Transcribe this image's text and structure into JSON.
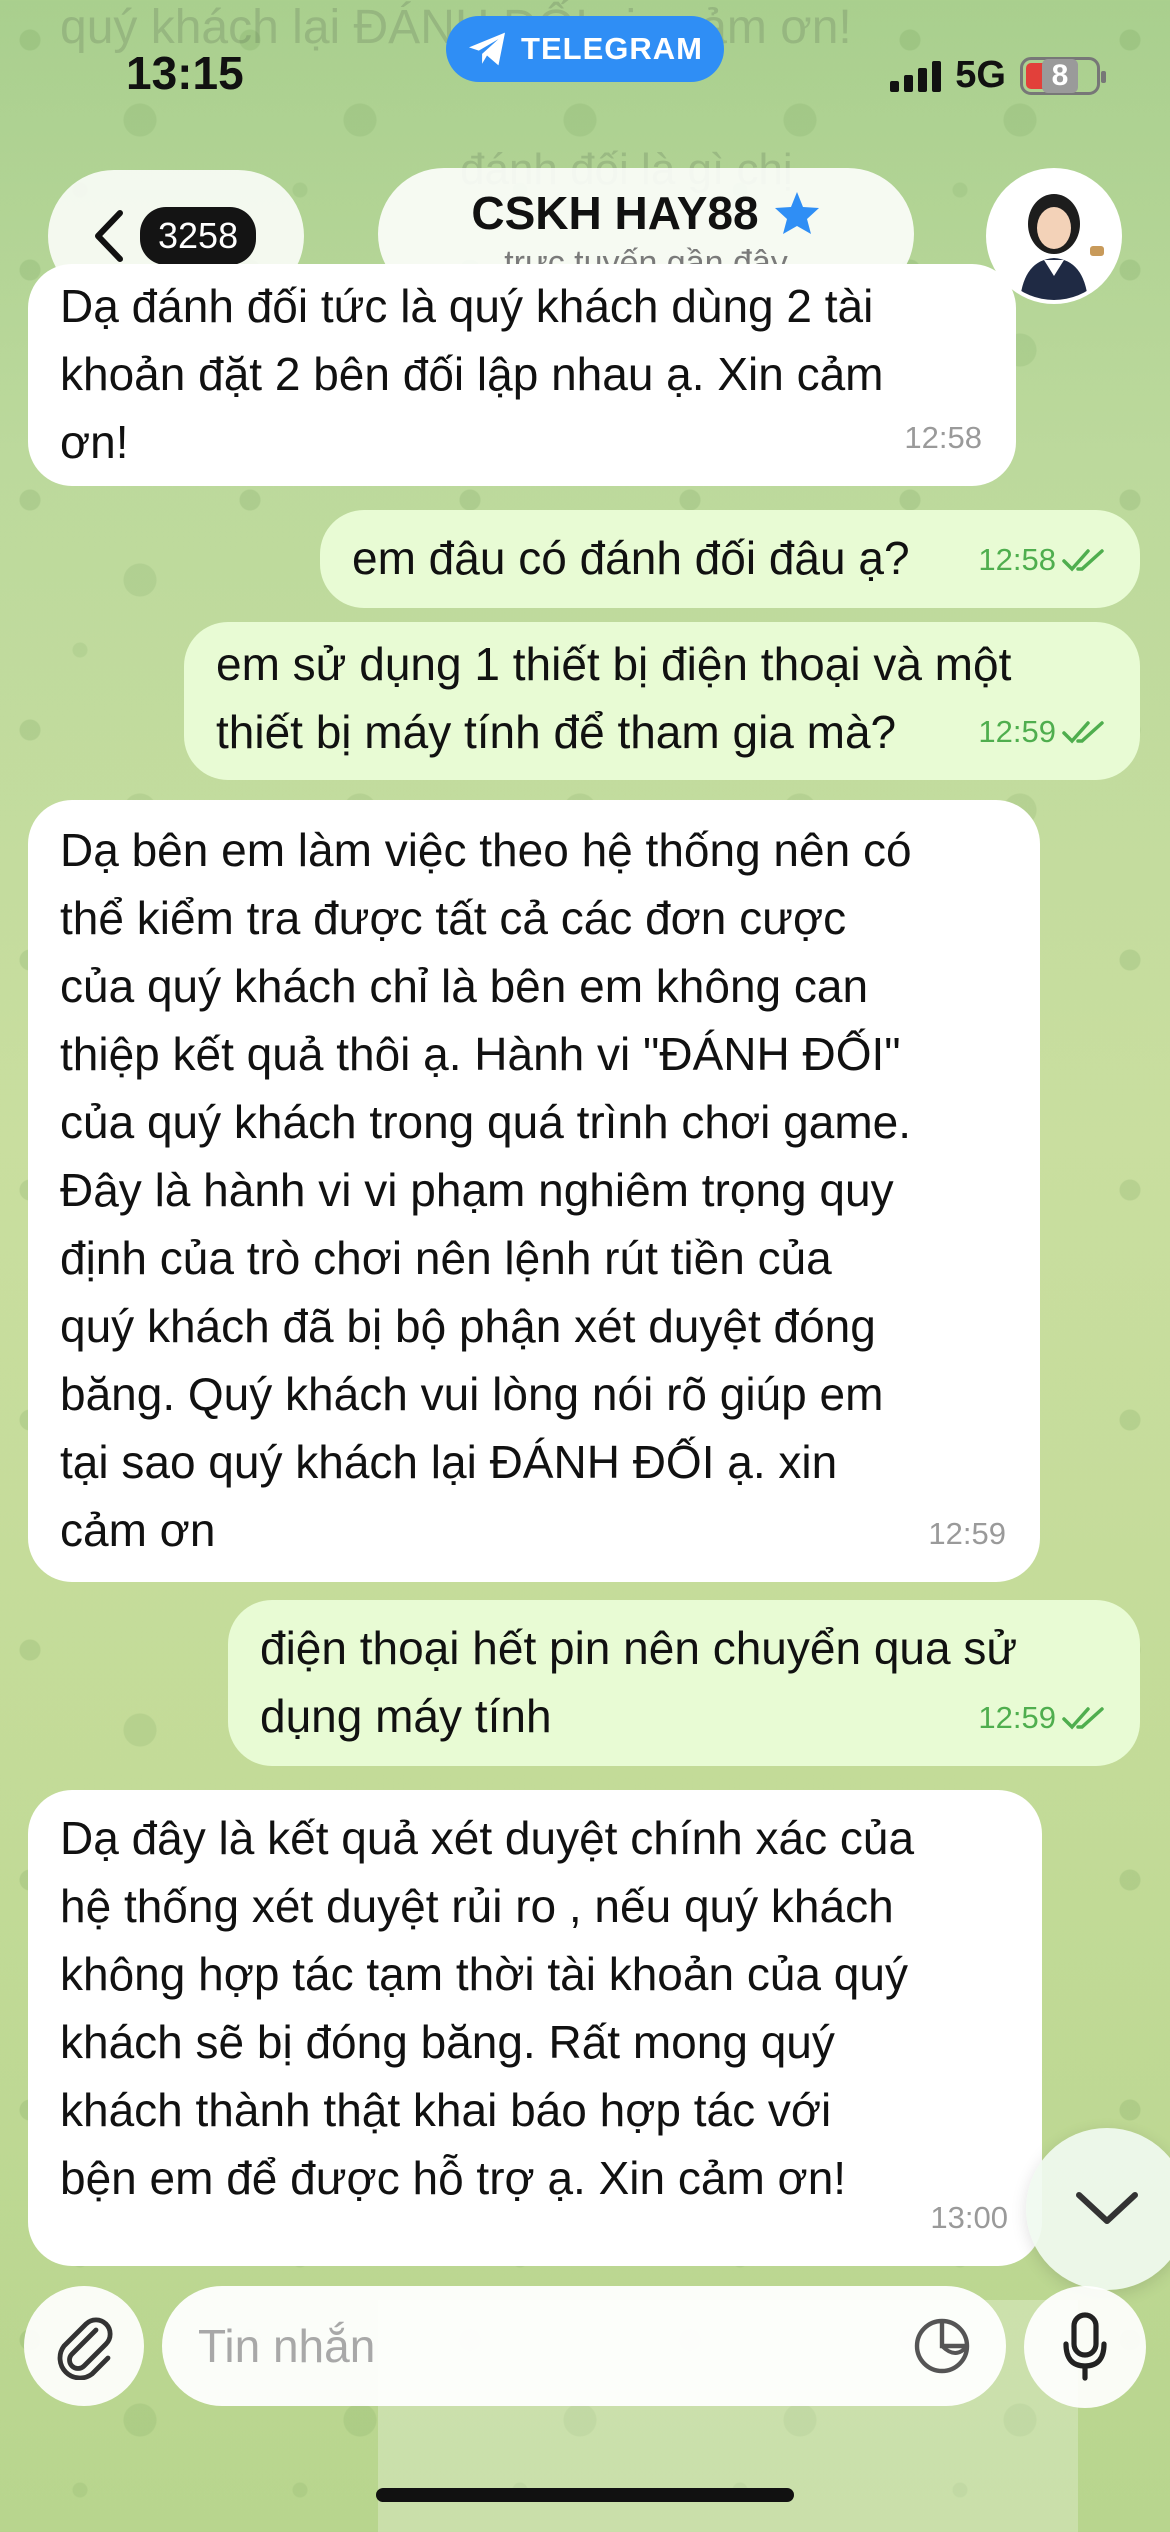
{
  "status_bar": {
    "time": "13:15",
    "app_pill": "TELEGRAM",
    "network": "5G",
    "battery": "8"
  },
  "header": {
    "back_count": "3258",
    "title": "CSKH HAY88",
    "subtitle": "trực tuyến gần đây",
    "verified_icon": "star-badge-icon"
  },
  "background_text": {
    "top": "quý khách lại ĐÁNH ĐỐI xin cảm ơn!",
    "second": "đánh đối là gì chị"
  },
  "messages": [
    {
      "direction": "in",
      "text": "Dạ đánh đối tức là quý khách dùng 2 tài\nkhoản đặt 2 bên đối lập nhau ạ. Xin cảm\nơn!",
      "time": "12:58"
    },
    {
      "direction": "out",
      "text": "em đâu có đánh đối đâu ạ?",
      "time": "12:58",
      "status": "read"
    },
    {
      "direction": "out",
      "text": "em sử dụng 1 thiết bị điện thoại và một\nthiết bị máy tính để tham gia mà?",
      "time": "12:59",
      "status": "read"
    },
    {
      "direction": "in",
      "text": "Dạ bên em làm việc theo hệ thống nên có\nthể kiểm tra được tất cả các đơn cược\ncủa quý khách chỉ là bên em không can\nthiệp kết quả thôi ạ. Hành vi \"ĐÁNH ĐỐI\"\ncủa quý khách trong quá trình chơi game.\nĐây là hành vi vi phạm nghiêm trọng quy\nđịnh của trò chơi nên lệnh rút tiền của\nquý khách đã bị bộ phận xét duyệt đóng\nbăng. Quý khách vui lòng nói rõ giúp em\ntại sao quý khách lại ĐÁNH ĐỐI ạ. xin\ncảm ơn",
      "time": "12:59"
    },
    {
      "direction": "out",
      "text": "điện thoại hết pin nên chuyển qua sử\ndụng máy tính",
      "time": "12:59",
      "status": "read"
    },
    {
      "direction": "in",
      "text": "Dạ đây là kết quả xét duyệt chính xác của\nhệ thống xét duyệt rủi ro , nếu quý khách\nkhông hợp tác tạm thời tài khoản của quý\nkhách sẽ bị đóng băng. Rất mong quý\nkhách thành thật khai báo hợp tác với\nbện em để được hỗ trợ ạ. Xin cảm ơn!",
      "time": "13:00"
    }
  ],
  "composer": {
    "placeholder": "Tin nhắn",
    "value": ""
  },
  "colors": {
    "telegram_blue": "#2f8ef5",
    "outgoing_bubble": "#e8fbd4",
    "incoming_bubble": "#ffffff",
    "read_check": "#4fae4e"
  }
}
